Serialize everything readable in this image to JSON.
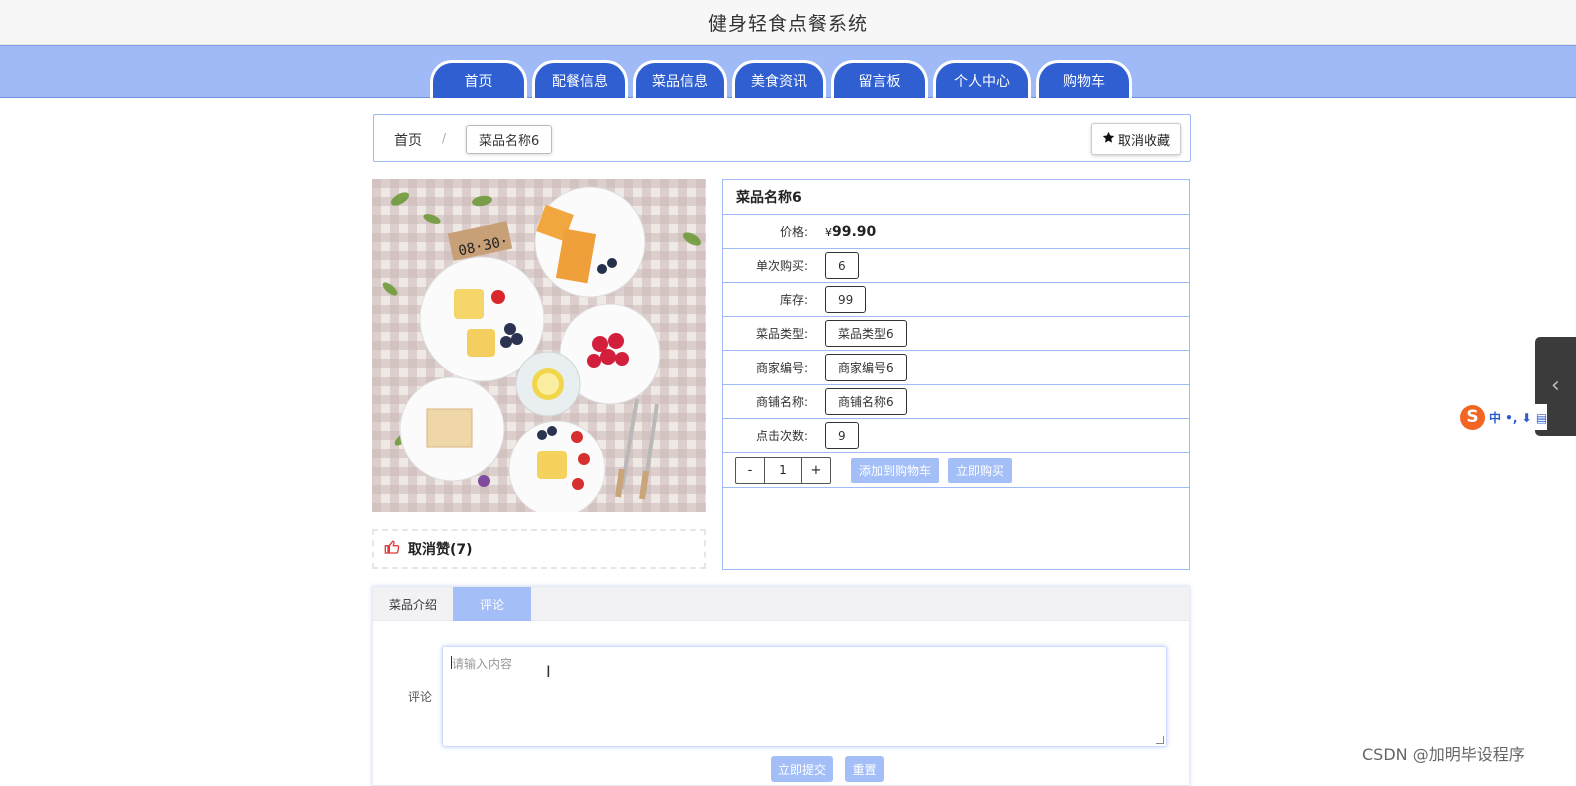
{
  "header": {
    "title": "健身轻食点餐系统"
  },
  "nav": {
    "items": [
      {
        "label": "首页",
        "w": 97
      },
      {
        "label": "配餐信息",
        "w": 96
      },
      {
        "label": "菜品信息",
        "w": 94
      },
      {
        "label": "美食资讯",
        "w": 94
      },
      {
        "label": "留言板",
        "w": 97
      },
      {
        "label": "个人中心",
        "w": 98
      },
      {
        "label": "购物车",
        "w": 96
      }
    ]
  },
  "breadcrumb": {
    "home": "首页",
    "separator": "/",
    "current": "菜品名称6",
    "favorite_button": "取消收藏"
  },
  "product": {
    "name": "菜品名称6",
    "price_label": "价格:",
    "price_symbol": "¥",
    "price": "99.90",
    "fields": [
      {
        "label": "单次购买:",
        "value": "6"
      },
      {
        "label": "库存:",
        "value": "99"
      },
      {
        "label": "菜品类型:",
        "value": "菜品类型6"
      },
      {
        "label": "商家编号:",
        "value": "商家编号6"
      },
      {
        "label": "商铺名称:",
        "value": "商铺名称6"
      },
      {
        "label": "点击次数:",
        "value": "9"
      }
    ],
    "quantity": {
      "minus": "-",
      "value": "1",
      "plus": "+"
    },
    "add_to_cart": "添加到购物车",
    "buy_now": "立即购买",
    "like": "取消赞(7)"
  },
  "tabs": [
    {
      "label": "菜品介绍",
      "active": false
    },
    {
      "label": "评论",
      "active": true
    }
  ],
  "comment": {
    "label": "评论",
    "placeholder": "请输入内容",
    "submit": "立即提交",
    "reset": "重置"
  },
  "ime": {
    "text": "中 •, ⬇ ▤"
  },
  "watermark": "CSDN @加明毕设程序"
}
